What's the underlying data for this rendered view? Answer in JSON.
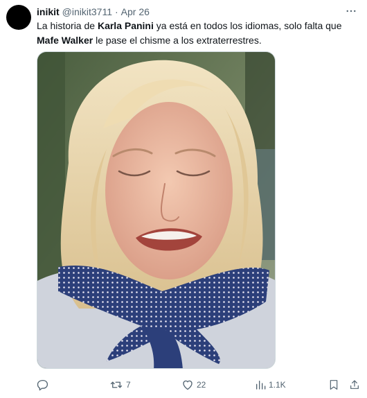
{
  "tweet": {
    "author": {
      "display_name": "inikit",
      "handle": "@inikit3711",
      "separator": "·",
      "date": "Apr 26"
    },
    "text": {
      "part1": "La historia de ",
      "mention1": "Karla Panini",
      "part2": " ya está en todos los idiomas, solo falta que ",
      "mention2": "Mafe Walker",
      "part3": " le pase el chisme a los extraterrestres."
    },
    "media": {
      "kind": "photo"
    },
    "actions": {
      "reply_count": "",
      "retweet_count": "7",
      "like_count": "22",
      "views_count": "1.1K"
    }
  },
  "icons": {
    "more": "more-horizontal-icon",
    "reply": "reply-icon",
    "retweet": "retweet-icon",
    "like": "heart-icon",
    "views": "views-bar-chart-icon",
    "bookmark": "bookmark-icon",
    "share": "share-upload-icon"
  },
  "colors": {
    "text_primary": "#0f1419",
    "text_secondary": "#536471",
    "border": "#cfd9de"
  }
}
